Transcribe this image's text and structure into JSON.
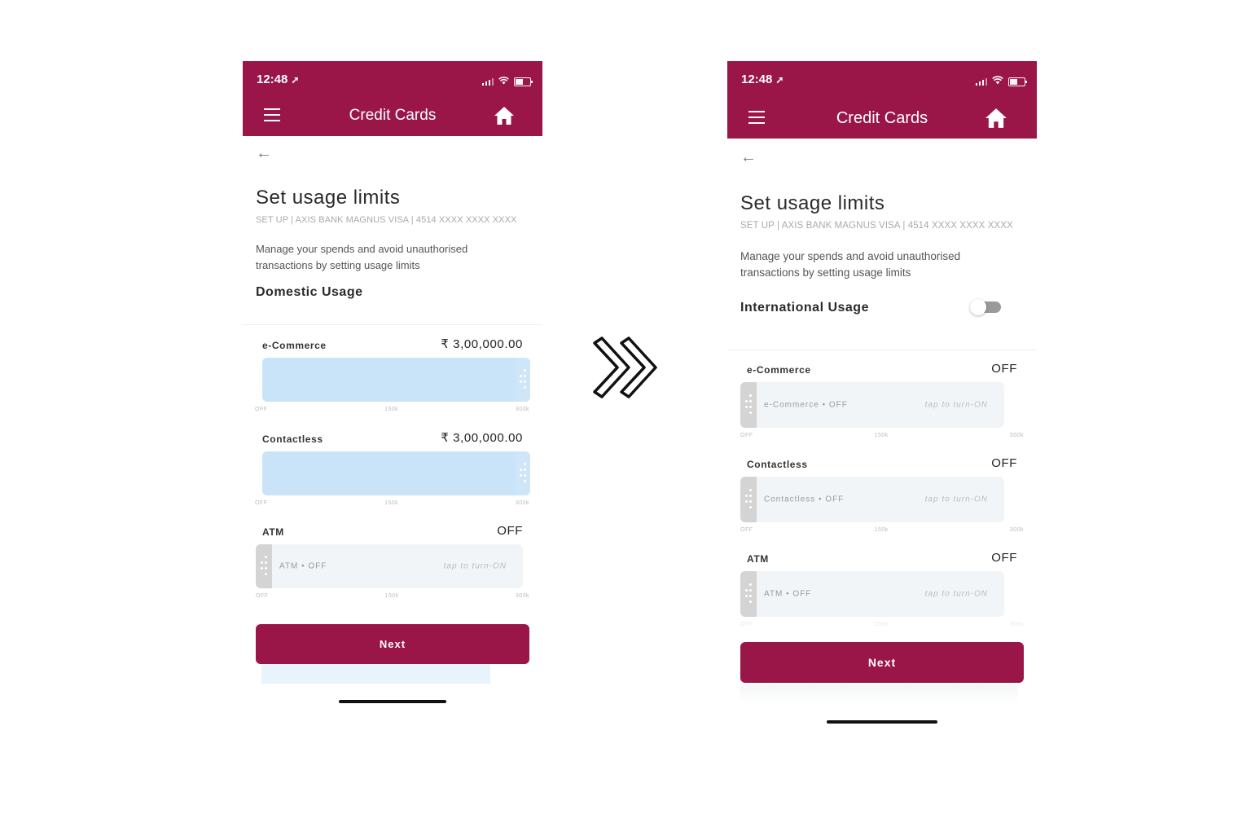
{
  "screens": [
    {
      "status_time": "12:48",
      "nav_title": "Credit Cards",
      "page_title": "Set usage limits",
      "subtitle": "SET UP | AXIS BANK MAGNUS VISA | 4514 XXXX XXXX XXXX",
      "description": "Manage your spends and avoid unauthorised transactions by setting usage limits",
      "usage_title": "Domestic Usage",
      "rows": [
        {
          "label": "e-Commerce",
          "value": "₹ 3,00,000.00",
          "state": "on",
          "fill_fraction": 1.0,
          "ticks": [
            "OFF",
            "150k",
            "300k"
          ]
        },
        {
          "label": "Contactless",
          "value": "₹ 3,00,000.00",
          "state": "on",
          "fill_fraction": 1.0,
          "ticks": [
            "OFF",
            "150k",
            "300k"
          ]
        },
        {
          "label": "ATM",
          "value": "OFF",
          "state": "off",
          "slider_text": "ATM  •  OFF",
          "hint": "tap to turn-ON",
          "ticks": [
            "OFF",
            "150k",
            "300k"
          ]
        }
      ],
      "next_label": "Next"
    },
    {
      "status_time": "12:48",
      "nav_title": "Credit Cards",
      "page_title": "Set usage limits",
      "subtitle": "SET UP | AXIS BANK MAGNUS VISA | 4514 XXXX XXXX XXXX",
      "description": "Manage your spends and avoid unauthorised transactions by setting usage limits",
      "usage_title": "International Usage",
      "toggle_on": false,
      "rows": [
        {
          "label": "e-Commerce",
          "value": "OFF",
          "state": "off",
          "slider_text": "e-Commerce  •  OFF",
          "hint": "tap to turn-ON",
          "ticks": [
            "OFF",
            "150k",
            "300k"
          ]
        },
        {
          "label": "Contactless",
          "value": "OFF",
          "state": "off",
          "slider_text": "Contactless  •  OFF",
          "hint": "tap to turn-ON",
          "ticks": [
            "OFF",
            "150k",
            "300k"
          ]
        },
        {
          "label": "ATM",
          "value": "OFF",
          "state": "off",
          "slider_text": "ATM  •  OFF",
          "hint": "tap to turn-ON",
          "ticks": [
            "OFF",
            "150k",
            "300k"
          ]
        }
      ],
      "next_label": "Next"
    }
  ],
  "colors": {
    "brand": "#9a1548",
    "slider_on": "#c9e3f8",
    "slider_off": "#f2f5f7"
  },
  "transition_icon": "double-chevron-right-icon"
}
